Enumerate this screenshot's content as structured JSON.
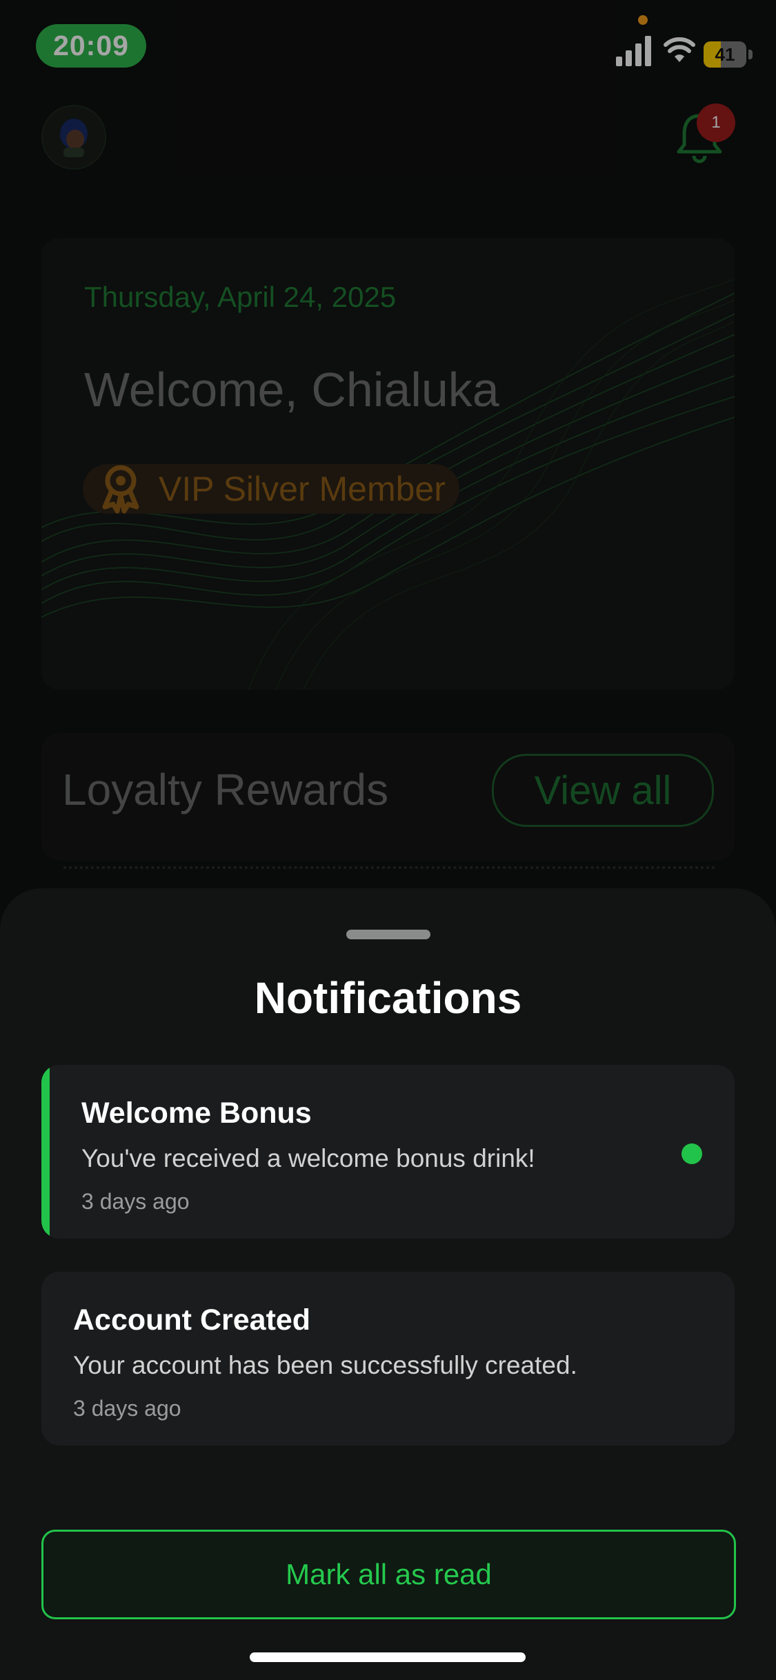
{
  "status_bar": {
    "time": "20:09",
    "battery_level": "41"
  },
  "header": {
    "notification_count": "1"
  },
  "welcome_card": {
    "date": "Thursday, April 24, 2025",
    "greeting": "Welcome, Chialuka",
    "membership": "VIP Silver Member"
  },
  "loyalty": {
    "title": "Loyalty Rewards",
    "view_all_label": "View all"
  },
  "sheet": {
    "title": "Notifications",
    "notifications": [
      {
        "title": "Welcome Bonus",
        "message": "You've received a welcome bonus drink!",
        "time": "3 days ago",
        "unread": true
      },
      {
        "title": "Account Created",
        "message": "Your account has been successfully created.",
        "time": "3 days ago",
        "unread": false
      }
    ],
    "mark_all_label": "Mark all as read"
  },
  "colors": {
    "accent_green": "#22c34a",
    "badge_red": "#9a1c1c",
    "vip_gold": "#8a5b17"
  }
}
